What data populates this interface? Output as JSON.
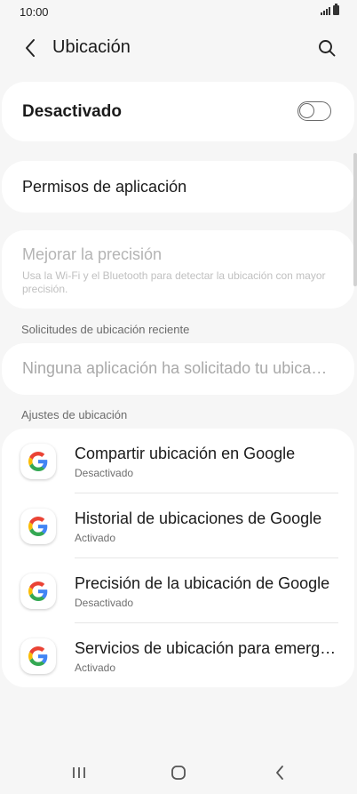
{
  "status_bar": {
    "time": "10:00"
  },
  "header": {
    "title": "Ubicación"
  },
  "master_switch": {
    "label": "Desactivado",
    "state": "off"
  },
  "permissions": {
    "label": "Permisos de aplicación"
  },
  "improve_accuracy": {
    "title": "Mejorar la precisión",
    "subtitle": "Usa la Wi-Fi y el Bluetooth para detectar la ubicación con mayor precisión."
  },
  "recent_requests": {
    "section_label": "Solicitudes de ubicación reciente",
    "empty_text": "Ninguna aplicación ha solicitado tu ubicación recientemente"
  },
  "location_settings": {
    "section_label": "Ajustes de ubicación",
    "items": [
      {
        "title": "Compartir ubicación en Google",
        "subtitle": "Desactivado",
        "icon": "google-icon"
      },
      {
        "title": "Historial de ubicaciones de Google",
        "subtitle": "Activado",
        "icon": "google-icon"
      },
      {
        "title": "Precisión de la ubicación de Google",
        "subtitle": "Desactivado",
        "icon": "google-icon"
      },
      {
        "title": "Servicios de ubicación para emergencias",
        "subtitle": "Activado",
        "icon": "google-icon"
      }
    ]
  },
  "colors": {
    "background": "#f6f6f6",
    "card": "#ffffff",
    "disabled_text": "#b4b4b4",
    "google_blue": "#4285F4",
    "google_red": "#EA4335",
    "google_yellow": "#FBBC05",
    "google_green": "#34A853"
  }
}
